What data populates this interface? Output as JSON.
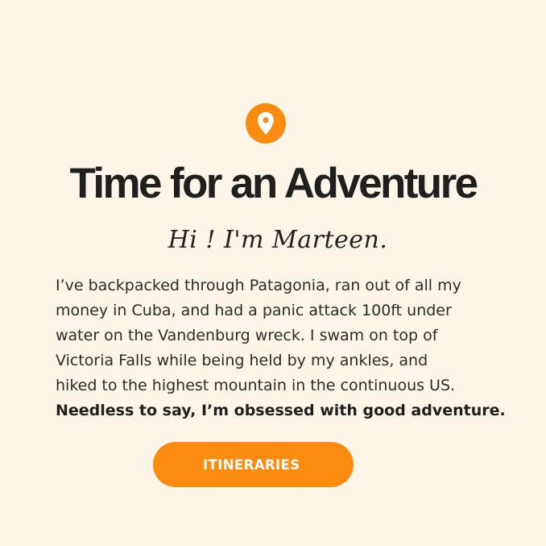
{
  "icon": {
    "name": "map-pin-icon",
    "color": "#fb8c0f"
  },
  "hero": {
    "title": "Time for an Adventure",
    "greeting": "Hi ! I'm Marteen."
  },
  "bio": {
    "lines": [
      "I’ve backpacked through Patagonia, ran out of all my",
      "money in Cuba, and had a panic attack 100ft under",
      "water on the Vandenburg wreck. I swam on top of",
      "Victoria Falls while being held by my ankles, and",
      "hiked to the highest mountain in the continuous US."
    ],
    "bold_line": "Needless to say, I’m obsessed with good adventure."
  },
  "cta": {
    "label": "ITINERARIES",
    "color": "#fb8c0f"
  }
}
